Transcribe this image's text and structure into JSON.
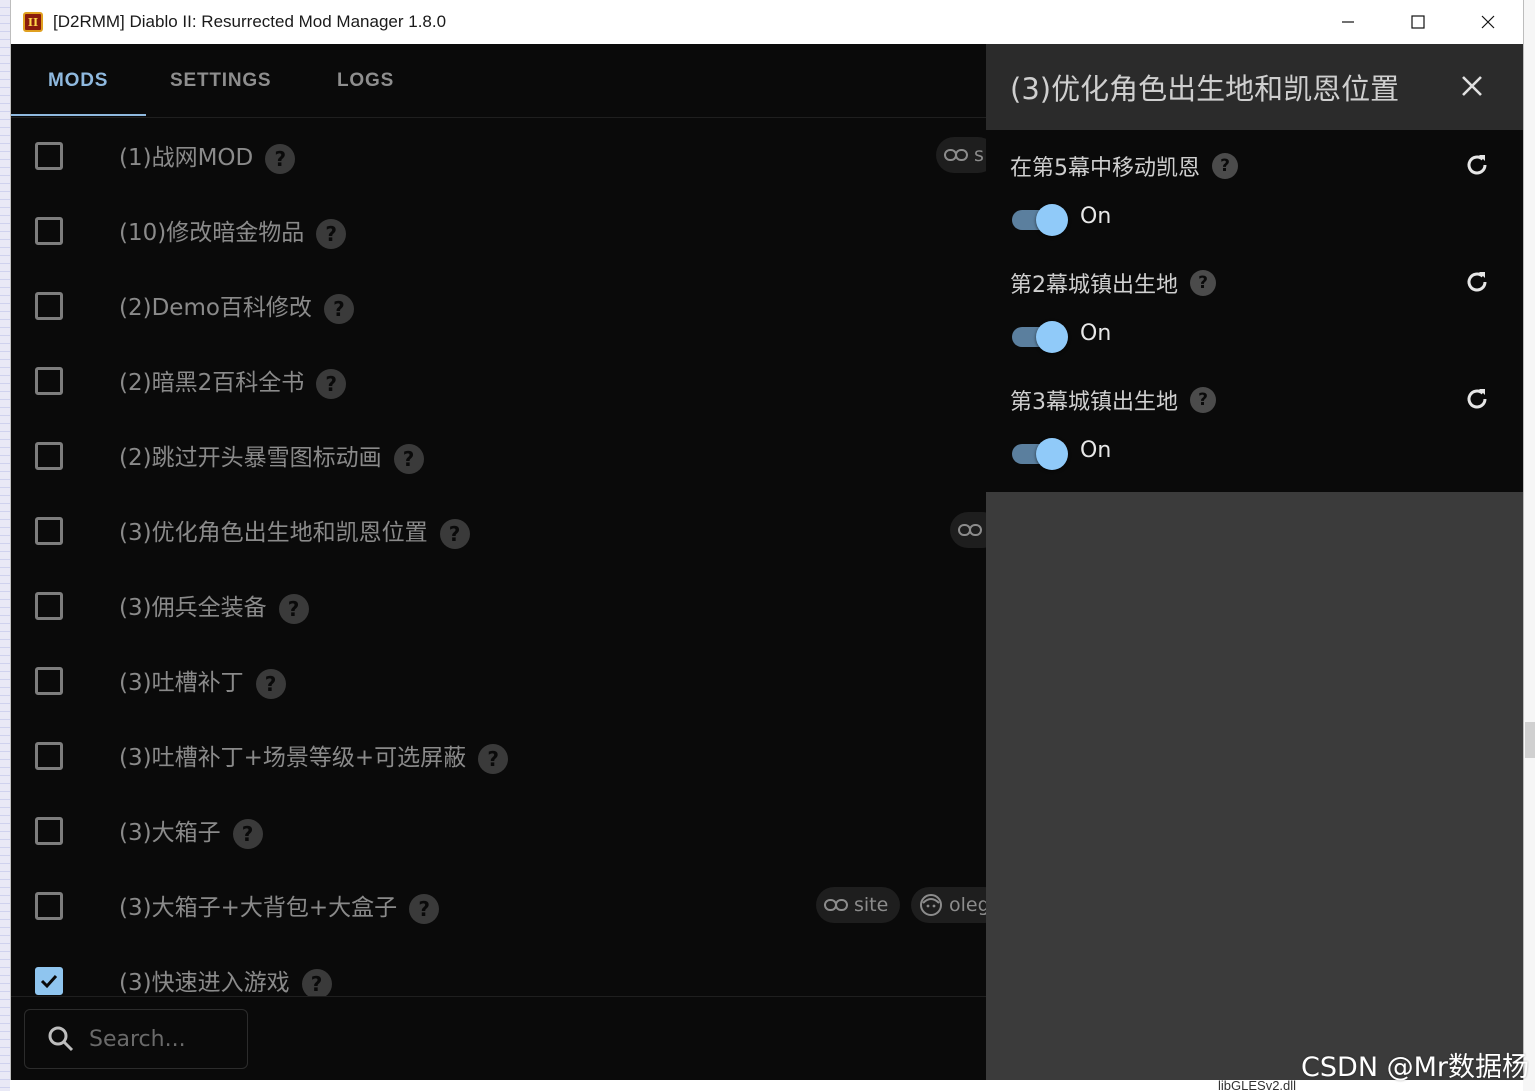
{
  "window": {
    "title": "[D2RMM] Diablo II: Resurrected Mod Manager 1.8.0"
  },
  "tabs": [
    {
      "label": "MODS",
      "active": true
    },
    {
      "label": "SETTINGS",
      "active": false
    },
    {
      "label": "LOGS",
      "active": false
    }
  ],
  "mods": [
    {
      "name": "(1)战网MOD",
      "checked": false
    },
    {
      "name": "(10)修改暗金物品",
      "checked": false
    },
    {
      "name": "(2)Demo百科修改",
      "checked": false
    },
    {
      "name": "(2)暗黑2百科全书",
      "checked": false
    },
    {
      "name": "(2)跳过开头暴雪图标动画",
      "checked": false
    },
    {
      "name": "(3)优化角色出生地和凯恩位置",
      "checked": false
    },
    {
      "name": "(3)佣兵全装备",
      "checked": false
    },
    {
      "name": "(3)吐槽补丁",
      "checked": false
    },
    {
      "name": "(3)吐槽补丁+场景等级+可选屏蔽",
      "checked": false
    },
    {
      "name": "(3)大箱子",
      "checked": false
    },
    {
      "name": "(3)大箱子+大背包+大盒子",
      "checked": false
    },
    {
      "name": "(3)快速进入游戏",
      "checked": true
    }
  ],
  "chips": {
    "row0_link": "s",
    "row10_site": "site",
    "row10_author": "oleg"
  },
  "help_glyph": "?",
  "search": {
    "placeholder": "Search..."
  },
  "drawer": {
    "title": "(3)优化角色出生地和凯恩位置",
    "settings": [
      {
        "label": "在第5幕中移动凯恩",
        "value": "On"
      },
      {
        "label": "第2幕城镇出生地",
        "value": "On"
      },
      {
        "label": "第3幕城镇出生地",
        "value": "On"
      }
    ]
  },
  "background": {
    "bottom_fragment": "libGLESv2.dll"
  },
  "watermark": "CSDN @Mr数据杨",
  "colors": {
    "accent": "#90caf9",
    "tab_active": "#8fb9df",
    "background": "#0a0a0a",
    "drawer": "#3b3b3b"
  },
  "icons": [
    "app-icon",
    "minimize-icon",
    "maximize-icon",
    "close-icon",
    "help-icon",
    "link-icon",
    "author-avatar-icon",
    "search-icon",
    "reset-icon",
    "checkmark-icon"
  ]
}
